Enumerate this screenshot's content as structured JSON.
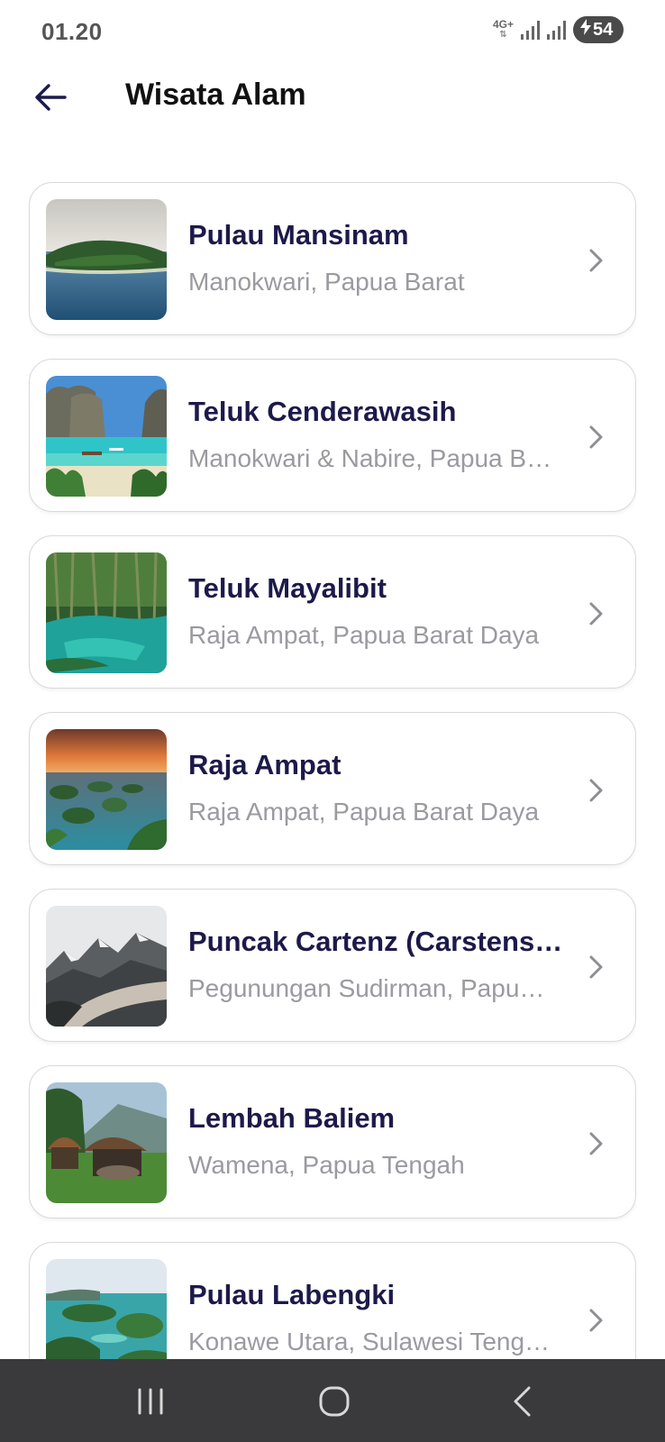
{
  "status_bar": {
    "time": "01.20",
    "network": "4G+",
    "battery": "54"
  },
  "header": {
    "title": "Wisata Alam"
  },
  "destinations": [
    {
      "title": "Pulau Mansinam",
      "subtitle": "Manokwari, Papua Barat"
    },
    {
      "title": "Teluk Cenderawasih",
      "subtitle": "Manokwari & Nabire, Papua Barat"
    },
    {
      "title": "Teluk Mayalibit",
      "subtitle": "Raja Ampat, Papua Barat Daya"
    },
    {
      "title": "Raja Ampat",
      "subtitle": "Raja Ampat, Papua Barat Daya"
    },
    {
      "title": "Puncak Cartenz (Carstensz Pyramid)",
      "subtitle": "Pegunungan Sudirman, Papua Tengah"
    },
    {
      "title": "Lembah Baliem",
      "subtitle": "Wamena, Papua Tengah"
    },
    {
      "title": "Pulau Labengki",
      "subtitle": "Konawe Utara, Sulawesi Tenggara"
    }
  ],
  "icons": {
    "back": "arrow-left-icon",
    "chevron": "chevron-right-icon",
    "nav_recents": "recents-icon",
    "nav_home": "home-icon",
    "nav_back": "back-icon"
  },
  "colors": {
    "title_text": "#1c1a4a",
    "subtitle_text": "#9a9aa0",
    "card_border": "#d9d9de",
    "nav_bar": "#3a3a3c"
  }
}
